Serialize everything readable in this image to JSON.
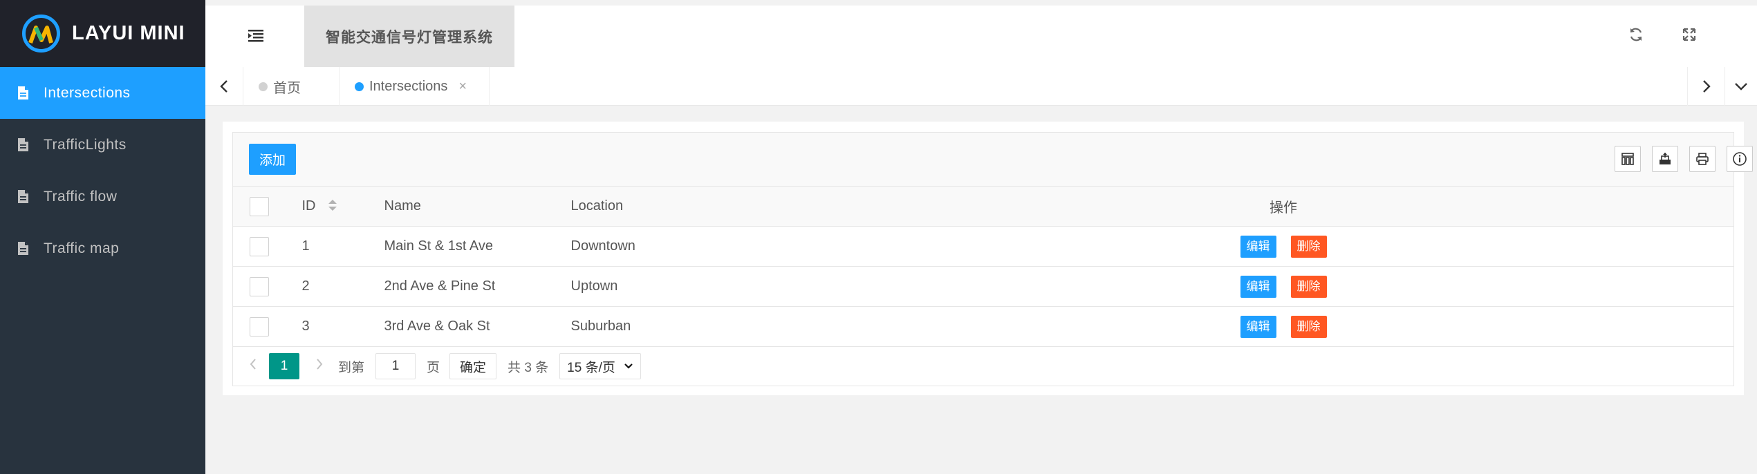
{
  "sidebar": {
    "logo_text": "LAYUI MINI",
    "items": [
      {
        "label": "Intersections",
        "active": true,
        "icon": "file-icon"
      },
      {
        "label": "TrafficLights",
        "active": false,
        "icon": "file-icon"
      },
      {
        "label": "Traffic flow",
        "active": false,
        "icon": "file-icon"
      },
      {
        "label": "Traffic map",
        "active": false,
        "icon": "file-icon"
      }
    ]
  },
  "header": {
    "system_title": "智能交通信号灯管理系统",
    "icons": [
      "menu-fold-icon",
      "refresh-icon",
      "fullscreen-icon"
    ]
  },
  "tabs": [
    {
      "label": "首页",
      "active": false
    },
    {
      "label": "Intersections",
      "active": true,
      "closable": true
    }
  ],
  "toolbar": {
    "add_label": "添加",
    "tool_icons": [
      "columns-icon",
      "export-icon",
      "print-icon",
      "info-icon"
    ]
  },
  "table": {
    "columns": [
      "ID",
      "Name",
      "Location",
      "操作"
    ],
    "rows": [
      {
        "id": "1",
        "name": "Main St & 1st Ave",
        "location": "Downtown"
      },
      {
        "id": "2",
        "name": "2nd Ave & Pine St",
        "location": "Uptown"
      },
      {
        "id": "3",
        "name": "3rd Ave & Oak St",
        "location": "Suburban"
      }
    ],
    "edit_label": "编辑",
    "delete_label": "删除"
  },
  "pager": {
    "current_page": "1",
    "goto_label": "到第",
    "goto_value": "1",
    "page_unit": "页",
    "confirm_label": "确定",
    "total_label": "共 3 条",
    "per_page": "15 条/页"
  },
  "colors": {
    "sidebar_bg": "#28333e",
    "logo_bg": "#20222a",
    "accent": "#1e9fff",
    "danger": "#ff5722",
    "pager_active": "#009688"
  }
}
